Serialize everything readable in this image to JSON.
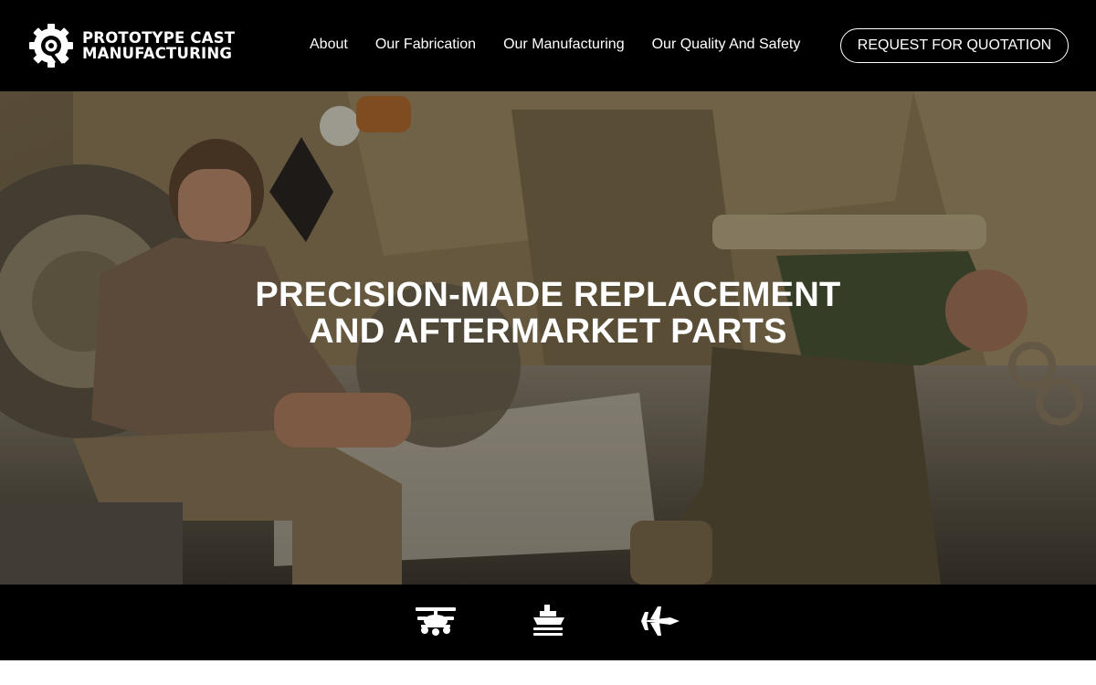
{
  "brand": {
    "name_line1": "PROTOTYPE CAST",
    "name_line2": "MANUFACTURING",
    "logo_icon": "gear-logo-icon"
  },
  "nav": {
    "items": [
      {
        "label": "About"
      },
      {
        "label": "Our Fabrication"
      },
      {
        "label": "Our Manufacturing"
      },
      {
        "label": "Our Quality And Safety"
      }
    ],
    "cta_label": "REQUEST FOR QUOTATION"
  },
  "hero": {
    "title_line1": "PRECISION-MADE REPLACEMENT",
    "title_line2": "AND AFTERMARKET PARTS",
    "image": "soldiers-repairing-armored-vehicle-photo"
  },
  "categories": [
    {
      "icon": "helicopter-icon"
    },
    {
      "icon": "ship-icon"
    },
    {
      "icon": "fighter-jet-icon"
    }
  ],
  "colors": {
    "header_bg": "#000000",
    "strip_bg": "#000000",
    "text": "#ffffff",
    "page_bg": "#ffffff"
  }
}
